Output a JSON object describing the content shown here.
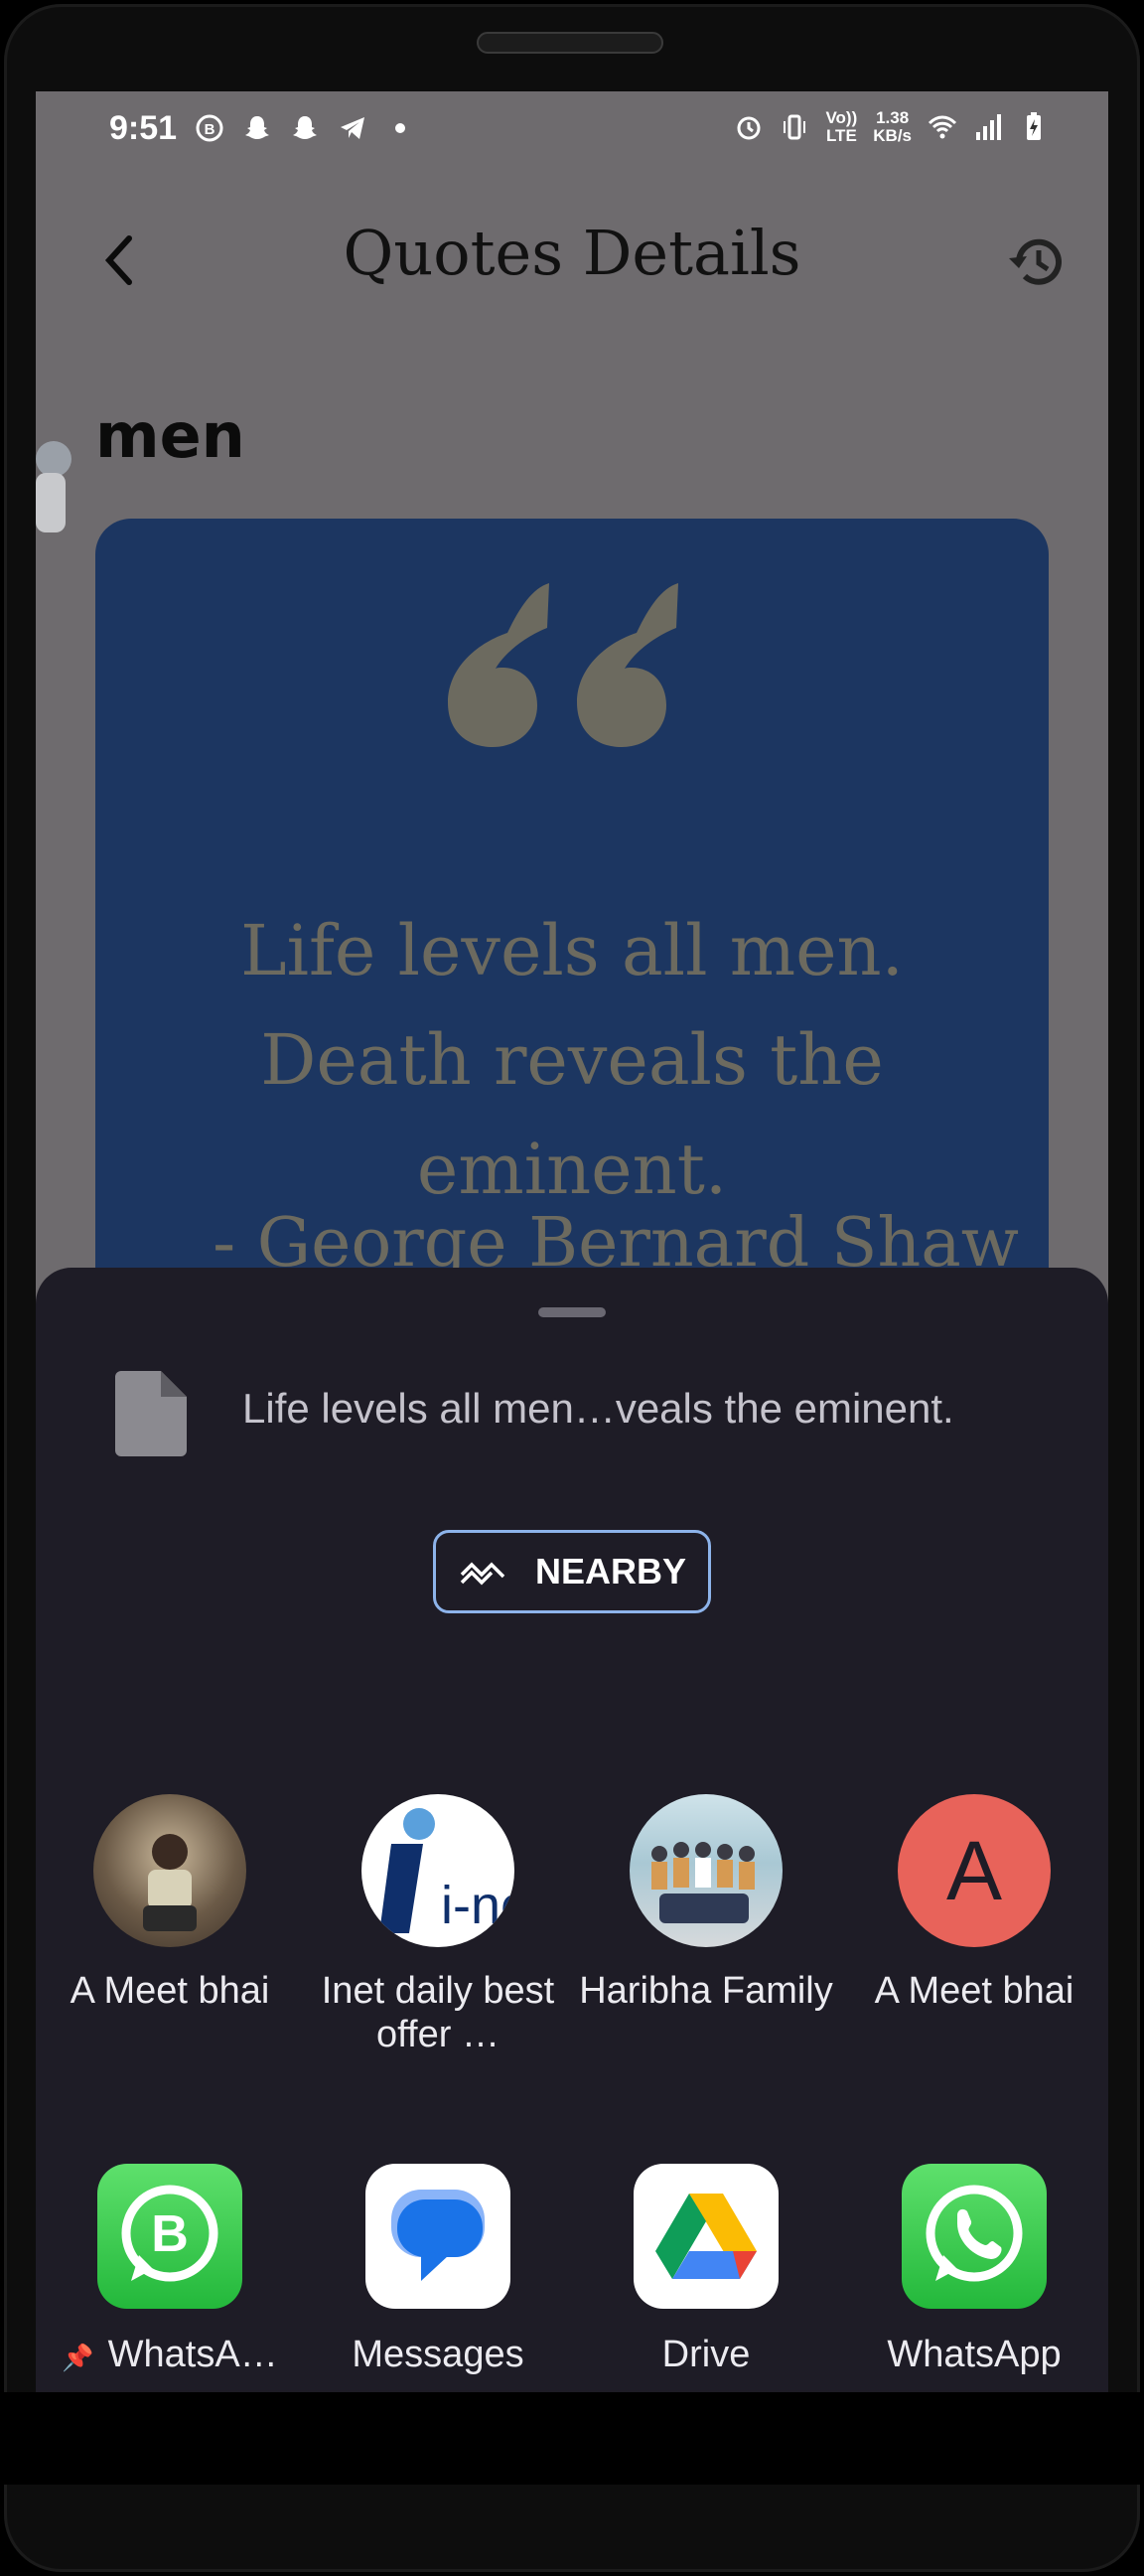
{
  "status_bar": {
    "time": "9:51",
    "speed_top": "1.38",
    "speed_bottom": "KB/s",
    "volte_top": "Vo))",
    "volte_bottom": "LTE"
  },
  "header": {
    "title": "Quotes Details"
  },
  "category": "men",
  "quote": {
    "text": "Life levels all men. Death reveals the eminent.",
    "author": "- George Bernard Shaw"
  },
  "share_sheet": {
    "preview_text": "Life levels all men…veals the eminent.",
    "nearby_label": "NEARBY",
    "contacts": [
      {
        "name": "A Meet bhai"
      },
      {
        "name": "Inet daily best offer …",
        "logo_text": "i-net"
      },
      {
        "name": "Haribha Family"
      },
      {
        "name": "A Meet bhai",
        "initial": "A"
      }
    ],
    "apps": [
      {
        "name": "WhatsA…",
        "badge": "B"
      },
      {
        "name": "Messages"
      },
      {
        "name": "Drive"
      },
      {
        "name": "WhatsApp"
      }
    ]
  },
  "colors": {
    "card": "#1c3661",
    "sheet": "#1e1c26",
    "nearby_border": "#8db3ea",
    "avatar_red": "#e8635a",
    "whatsapp_green": "#2bd34a"
  }
}
